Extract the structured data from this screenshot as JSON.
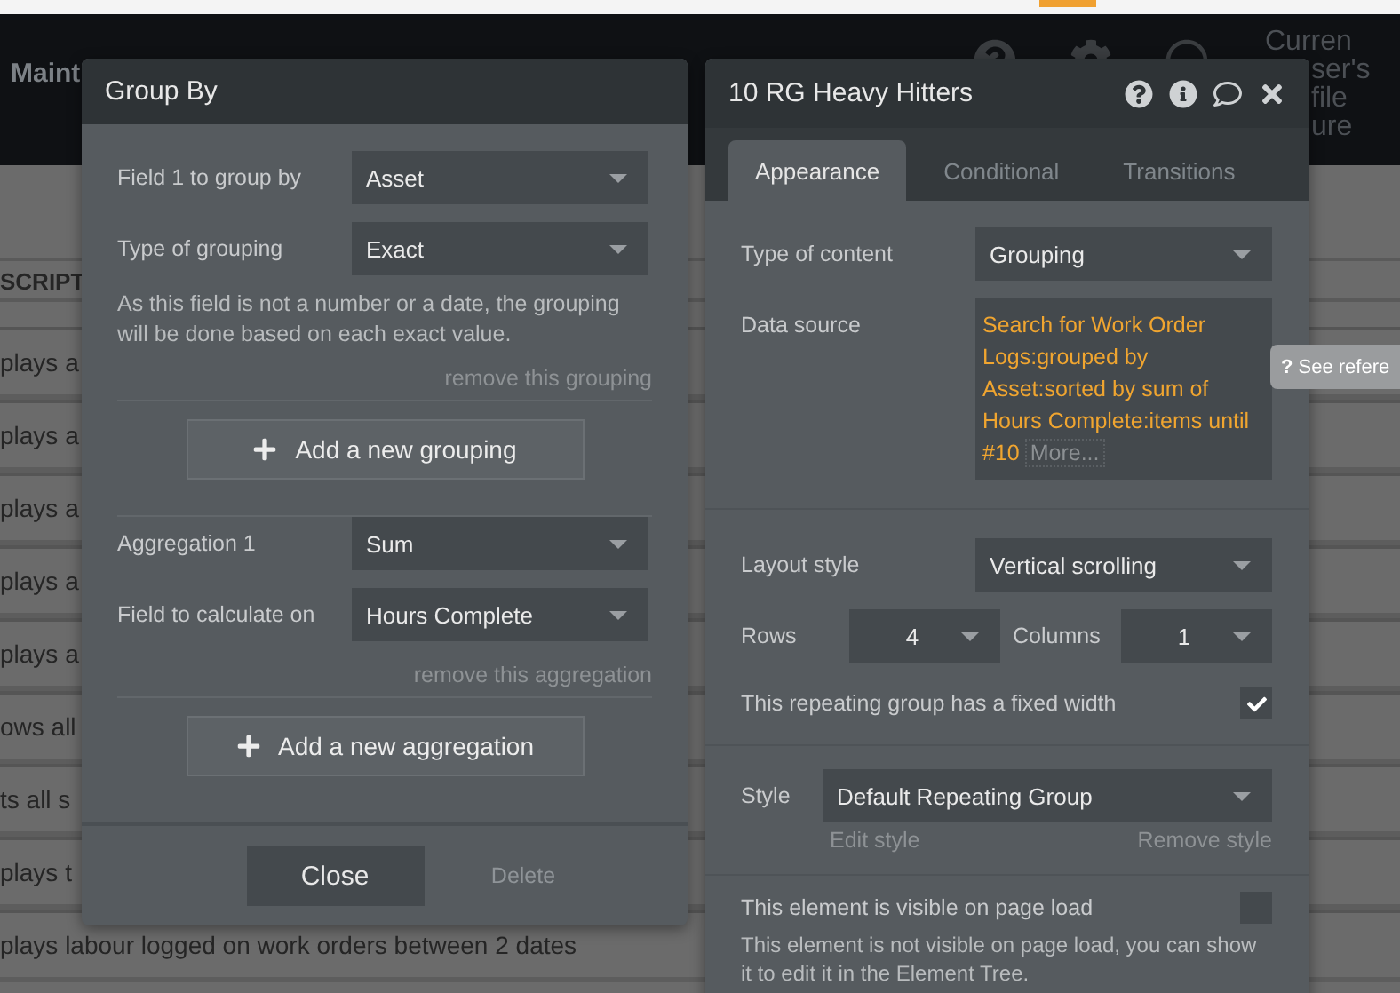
{
  "app_header": {
    "title": "Maint",
    "user_label": [
      "Curren",
      "ser's",
      "file",
      "ure"
    ]
  },
  "background_table": {
    "heading": "SCRIPT",
    "rows": [
      "plays a",
      "plays a",
      "plays a",
      "plays a",
      "plays a",
      "ows all",
      "ts all s",
      "plays t",
      "plays labour logged on work orders between 2 dates"
    ]
  },
  "group_by_panel": {
    "title": "Group By",
    "groupings": [
      {
        "label": "Field 1 to group by",
        "value": "Asset"
      },
      {
        "label": "Type of grouping",
        "value": "Exact"
      }
    ],
    "note": "As this field is not a number or a date, the grouping will be done based on each exact value.",
    "remove_grouping": "remove this grouping",
    "add_grouping": "Add a new grouping",
    "aggregations": [
      {
        "label": "Aggregation 1",
        "value": "Sum"
      },
      {
        "label": "Field to calculate on",
        "value": "Hours Complete"
      }
    ],
    "remove_aggregation": "remove this aggregation",
    "add_aggregation": "Add a new aggregation",
    "buttons": [
      {
        "label": "Close",
        "disabled": false
      },
      {
        "label": "Delete",
        "disabled": true
      }
    ]
  },
  "element_panel": {
    "title": "10 RG Heavy Hitters",
    "tabs": [
      {
        "label": "Appearance",
        "selected": true
      },
      {
        "label": "Conditional",
        "selected": false
      },
      {
        "label": "Transitions",
        "selected": false
      }
    ],
    "type_of_content": {
      "label": "Type of content",
      "value": "Grouping"
    },
    "data_source": {
      "label": "Data source",
      "expression": "Search for Work Order Logs:grouped by Asset:sorted by sum of Hours Complete:items until #10",
      "more": "More..."
    },
    "layout_style": {
      "label": "Layout style",
      "value": "Vertical scrolling"
    },
    "rows": {
      "label": "Rows",
      "value": "4"
    },
    "columns": {
      "label": "Columns",
      "value": "1"
    },
    "fixed_width": {
      "label": "This repeating group has a fixed width",
      "checked": true
    },
    "style": {
      "label": "Style",
      "value": "Default Repeating Group",
      "edit": "Edit style",
      "remove": "Remove style"
    },
    "visible_on_load": {
      "label": "This element is visible on page load",
      "checked": false
    },
    "visibility_note": "This element is not visible on page load, you can show it to edit it in the Element Tree."
  },
  "tooltip": {
    "icon": "?",
    "text": "See refere"
  }
}
